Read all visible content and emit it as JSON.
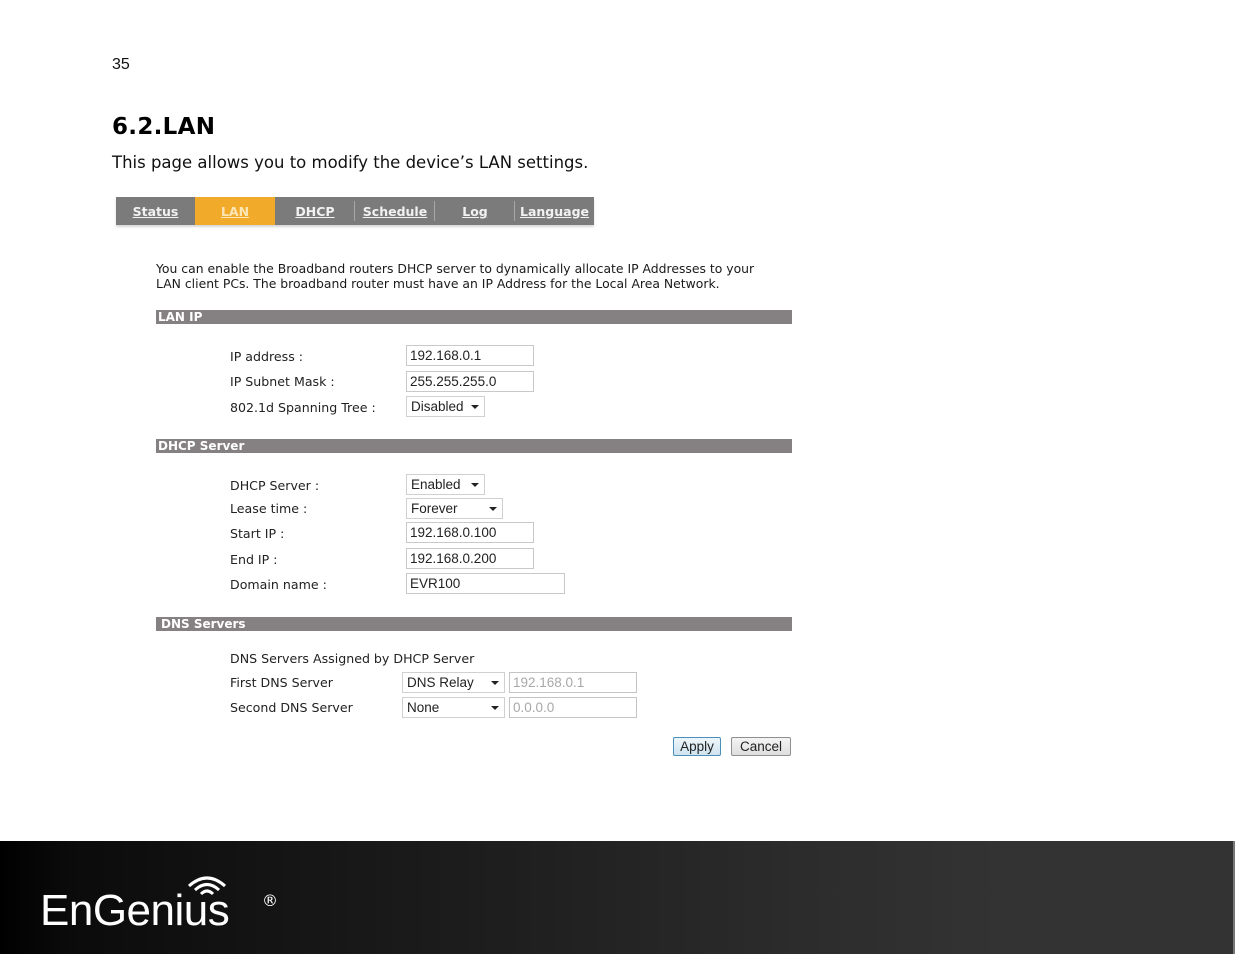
{
  "page": {
    "page_number": "35",
    "section_title": "6.2.LAN",
    "section_intro": "This page allows you to modify the device’s LAN settings."
  },
  "router_ui": {
    "nav_tabs": [
      {
        "label": "Status",
        "active": false
      },
      {
        "label": "LAN",
        "active": true
      },
      {
        "label": "DHCP",
        "active": false
      },
      {
        "label": "Schedule",
        "active": false
      },
      {
        "label": "Log",
        "active": false
      },
      {
        "label": "Language",
        "active": false
      }
    ],
    "intro_line1": "You can enable the Broadband routers DHCP server to dynamically allocate IP Addresses to your",
    "intro_line2": "LAN client PCs. The broadband router must have an IP Address for the Local Area Network.",
    "lan_ip": {
      "header": "LAN IP",
      "ip_address_label": "IP address :",
      "ip_address_value": "192.168.0.1",
      "subnet_mask_label": "IP Subnet Mask :",
      "subnet_mask_value": "255.255.255.0",
      "spanning_tree_label": "802.1d Spanning Tree :",
      "spanning_tree_value": "Disabled"
    },
    "dhcp_server": {
      "header": "DHCP Server",
      "dhcp_server_label": "DHCP Server :",
      "dhcp_server_value": "Enabled",
      "lease_time_label": "Lease time :",
      "lease_time_value": "Forever",
      "start_ip_label": "Start IP :",
      "start_ip_value": "192.168.0.100",
      "end_ip_label": "End IP :",
      "end_ip_value": "192.168.0.200",
      "domain_name_label": "Domain name :",
      "domain_name_value": "EVR100"
    },
    "dns_servers": {
      "header": "DNS Servers",
      "assigned_label": "DNS Servers Assigned by DHCP Server",
      "first_dns_label": "First DNS Server",
      "first_dns_mode": "DNS Relay",
      "first_dns_ip": "192.168.0.1",
      "second_dns_label": "Second DNS Server",
      "second_dns_mode": "None",
      "second_dns_ip": "0.0.0.0"
    },
    "buttons": {
      "apply": "Apply",
      "cancel": "Cancel"
    },
    "colors": {
      "nav_bg": "#7b7b7b",
      "nav_active": "#f2aa2a",
      "section_bar": "#858081"
    }
  },
  "footer": {
    "brand": "EnGenius",
    "registered_mark": "®"
  }
}
